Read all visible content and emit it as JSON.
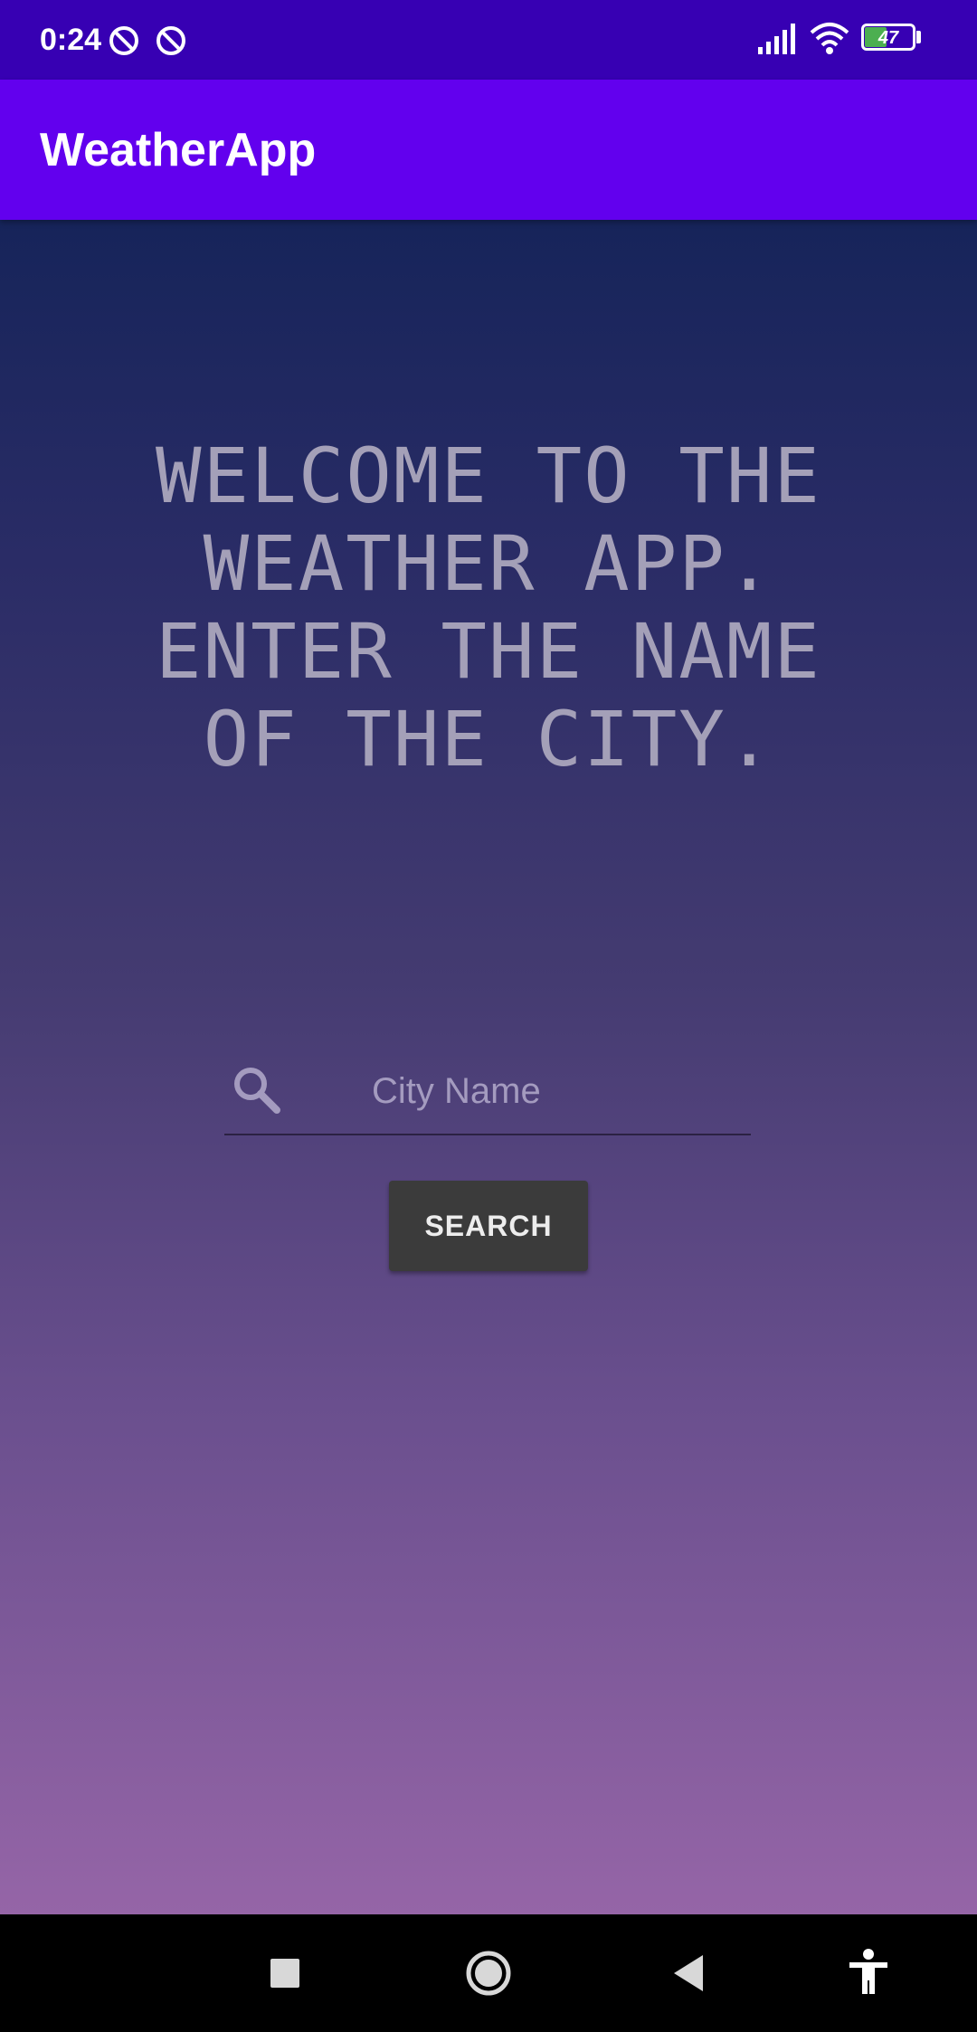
{
  "status_bar": {
    "time": "0:24",
    "battery_level": "47",
    "icons": [
      "dnd-icon",
      "dnd-icon",
      "signal-icon",
      "wifi-icon",
      "battery-icon"
    ]
  },
  "app_bar": {
    "title": "WeatherApp"
  },
  "main": {
    "welcome_lines": [
      "WELCOME TO THE",
      "WEATHER APP.",
      "ENTER THE NAME",
      "OF THE CITY."
    ],
    "search": {
      "placeholder": "City Name",
      "value": "",
      "icon": "search-icon"
    },
    "search_button_label": "SEARCH"
  },
  "nav_bar": {
    "buttons": [
      "recents-icon",
      "home-icon",
      "back-icon",
      "accessibility-icon"
    ]
  },
  "colors": {
    "status_bar": "#3700b3",
    "app_bar": "#6200ee",
    "button": "#3b3b3b",
    "welcome_text": "#a4a0b8",
    "gradient_top": "#16245a",
    "gradient_bottom": "#9565a7"
  }
}
